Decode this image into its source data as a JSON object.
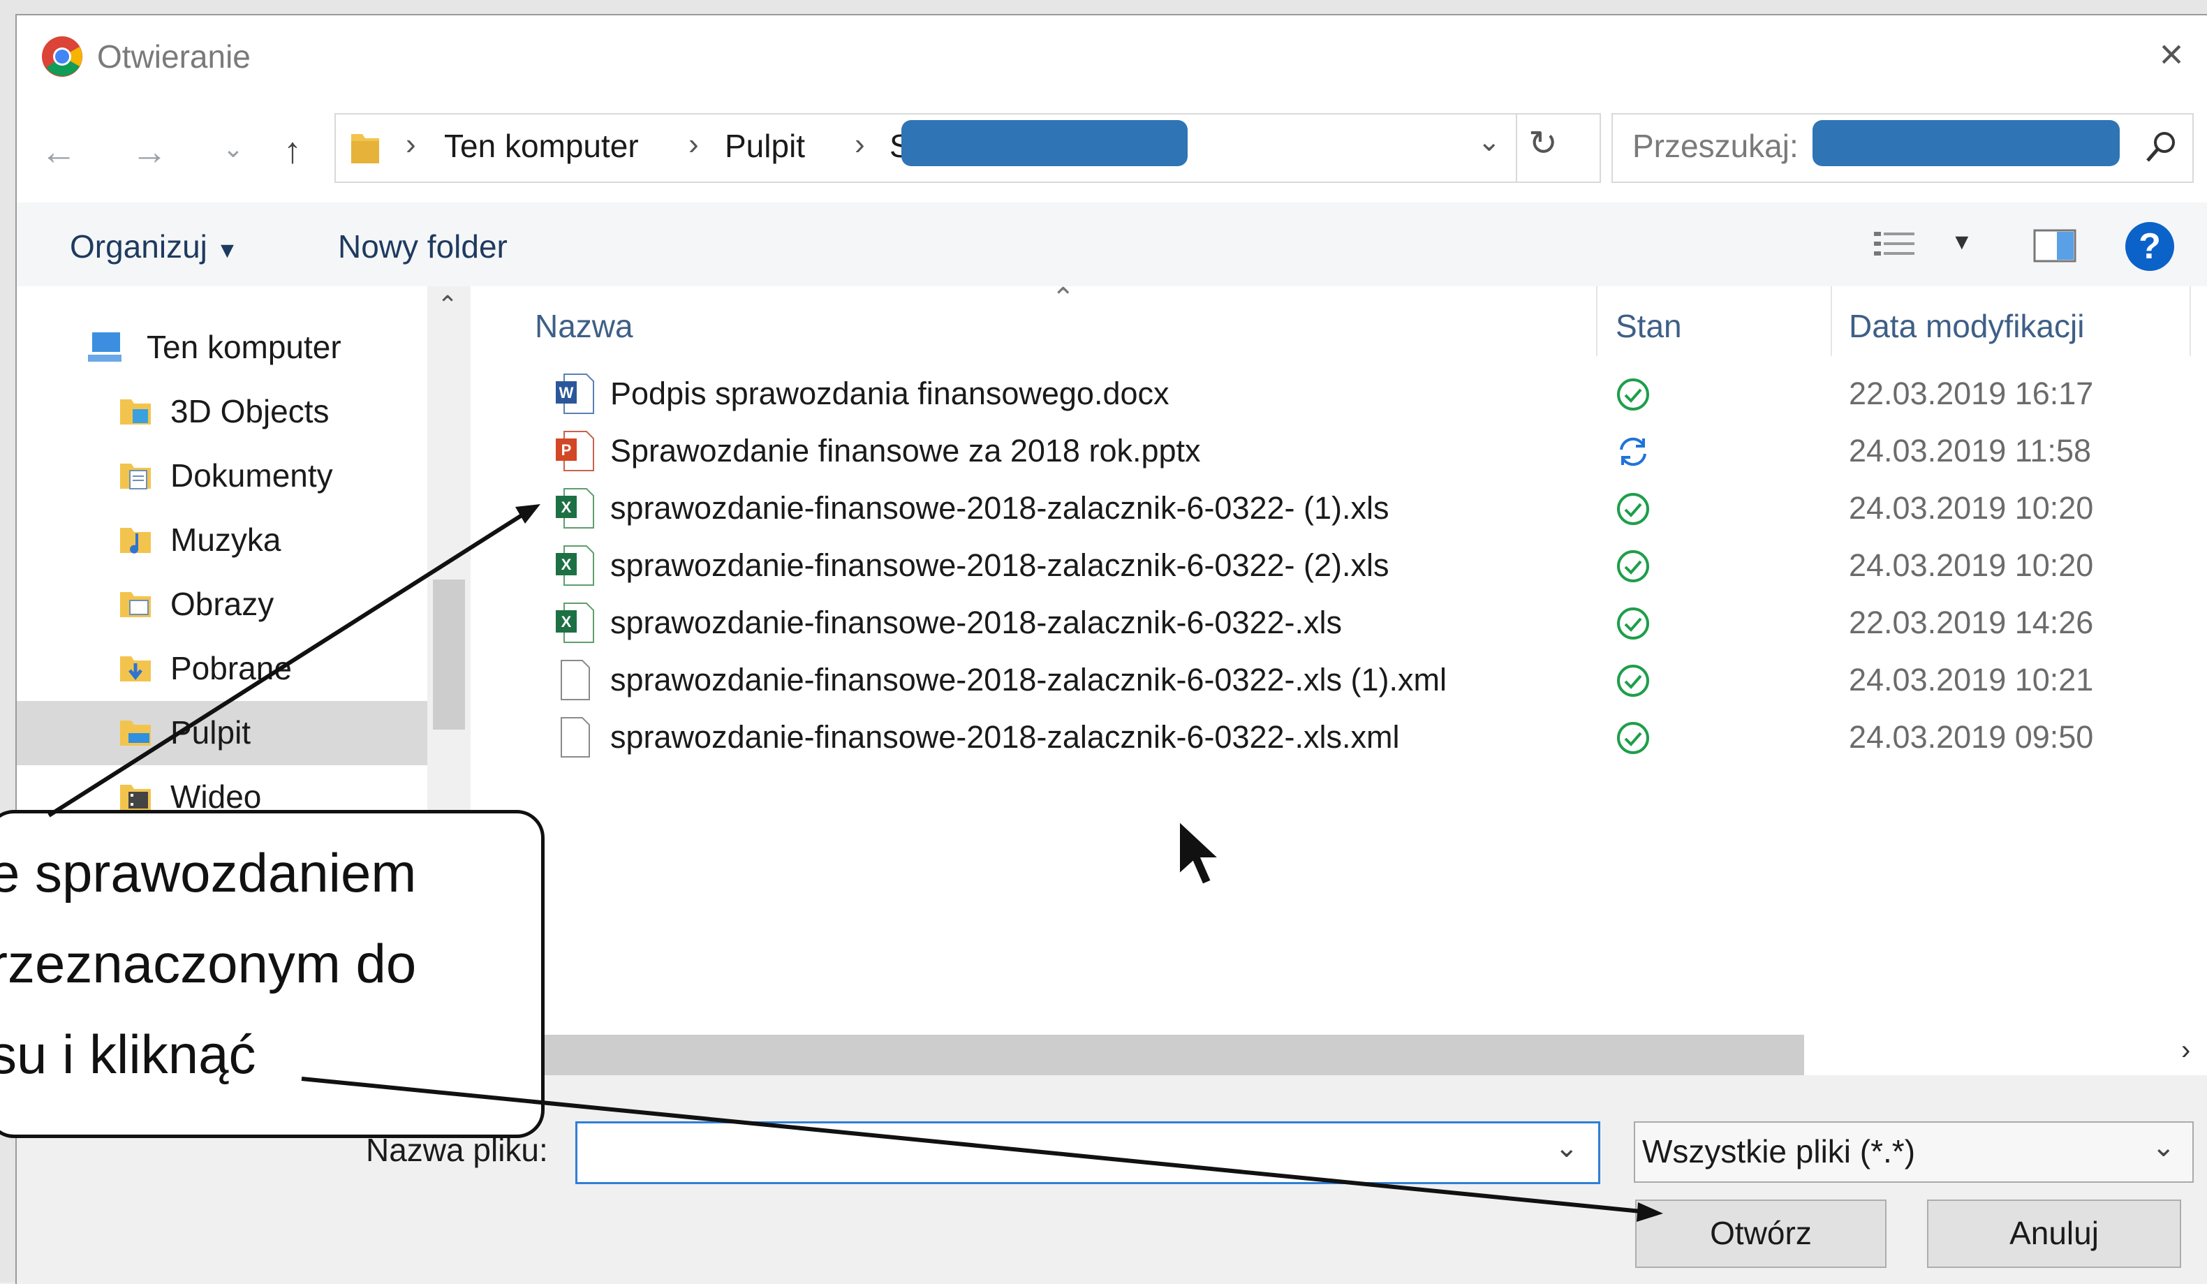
{
  "window": {
    "title": "Otwieranie"
  },
  "address": {
    "segments": [
      "Ten komputer",
      "Pulpit",
      "S"
    ]
  },
  "search": {
    "label": "Przeszukaj:"
  },
  "toolbar": {
    "organize_label": "Organizuj",
    "new_folder_label": "Nowy folder"
  },
  "nav_pane": {
    "root": "Ten komputer",
    "items": [
      {
        "label": "3D Objects",
        "icon": "folder-3d-icon"
      },
      {
        "label": "Dokumenty",
        "icon": "folder-documents-icon"
      },
      {
        "label": "Muzyka",
        "icon": "folder-music-icon"
      },
      {
        "label": "Obrazy",
        "icon": "folder-pictures-icon"
      },
      {
        "label": "Pobrane",
        "icon": "folder-downloads-icon"
      },
      {
        "label": "Pulpit",
        "icon": "folder-desktop-icon",
        "selected": true
      },
      {
        "label": "Wideo",
        "icon": "folder-video-icon"
      }
    ]
  },
  "columns": {
    "name": "Nazwa",
    "status": "Stan",
    "date": "Data modyfikacji"
  },
  "files": [
    {
      "name": "Podpis sprawozdania finansowego.docx",
      "type": "word",
      "status": "synced",
      "date": "22.03.2019 16:17"
    },
    {
      "name": "Sprawozdanie finansowe za 2018 rok.pptx",
      "type": "powerpoint",
      "status": "syncing",
      "date": "24.03.2019 11:58"
    },
    {
      "name": "sprawozdanie-finansowe-2018-zalacznik-6-0322- (1).xls",
      "type": "excel",
      "status": "synced",
      "date": "24.03.2019 10:20"
    },
    {
      "name": "sprawozdanie-finansowe-2018-zalacznik-6-0322- (2).xls",
      "type": "excel",
      "status": "synced",
      "date": "24.03.2019 10:20"
    },
    {
      "name": "sprawozdanie-finansowe-2018-zalacznik-6-0322-.xls",
      "type": "excel",
      "status": "synced",
      "date": "22.03.2019 14:26"
    },
    {
      "name": "sprawozdanie-finansowe-2018-zalacznik-6-0322-.xls (1).xml",
      "type": "generic",
      "status": "synced",
      "date": "24.03.2019 10:21"
    },
    {
      "name": "sprawozdanie-finansowe-2018-zalacznik-6-0322-.xls.xml",
      "type": "generic",
      "status": "synced",
      "date": "24.03.2019 09:50"
    }
  ],
  "bottom": {
    "filename_label": "Nazwa pliku:",
    "filename_value": "",
    "filetype_value": "Wszystkie pliki (*.*)",
    "open_label": "Otwórz",
    "cancel_label": "Anuluj"
  },
  "callout": {
    "lines": [
      "e sprawozdaniem",
      "rzeznaczonym do",
      "su i kliknąć"
    ]
  },
  "colors": {
    "accent": "#0b62c9",
    "redaction": "#2f74b5",
    "status_ok": "#1e9e4a",
    "status_sync": "#1f73d9"
  }
}
